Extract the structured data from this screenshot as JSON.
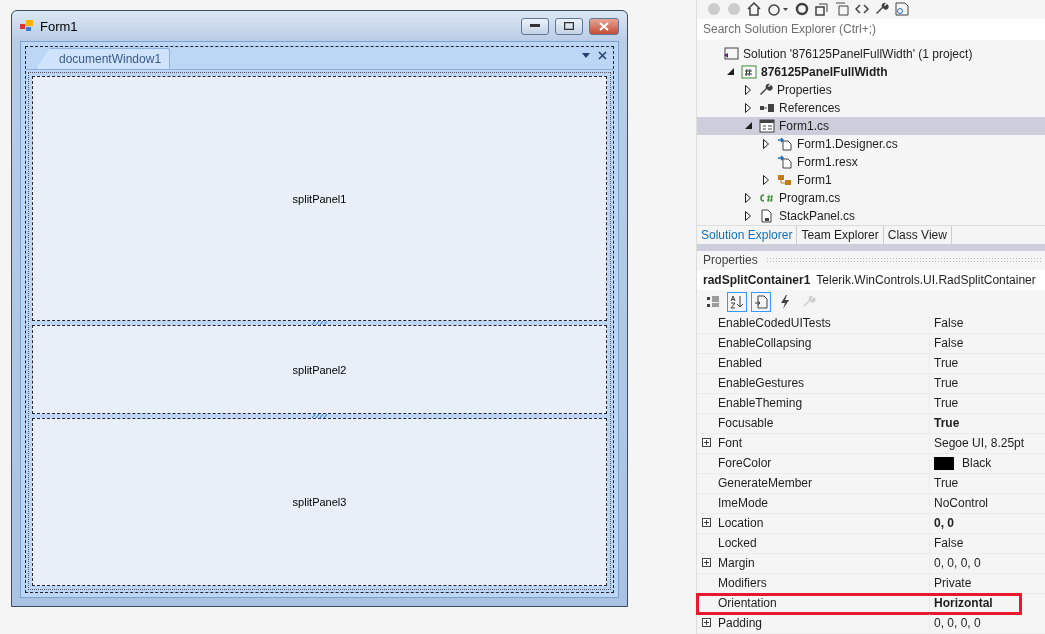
{
  "form": {
    "title": "Form1",
    "document_tab": {
      "label": "documentWindow1",
      "selected": true
    },
    "panels": [
      {
        "label": "splitPanel1"
      },
      {
        "label": "splitPanel2"
      },
      {
        "label": "splitPanel3"
      }
    ]
  },
  "solution_explorer": {
    "search": {
      "placeholder": "Search Solution Explorer (Ctrl+;)"
    },
    "tree": [
      {
        "label": "Solution '876125PanelFullWidth' (1 project)",
        "kind": "solution",
        "expandable": false,
        "bold": false,
        "selected": false,
        "children": [
          {
            "label": "876125PanelFullWidth",
            "kind": "csproject",
            "expandable": true,
            "expanded": true,
            "bold": true,
            "selected": false,
            "children": [
              {
                "label": "Properties",
                "kind": "properties",
                "expandable": true,
                "expanded": false,
                "bold": false,
                "selected": false
              },
              {
                "label": "References",
                "kind": "references",
                "expandable": true,
                "expanded": false,
                "bold": false,
                "selected": false
              },
              {
                "label": "Form1.cs",
                "kind": "form",
                "expandable": true,
                "expanded": true,
                "bold": false,
                "selected": true,
                "children": [
                  {
                    "label": "Form1.Designer.cs",
                    "kind": "designer",
                    "expandable": true,
                    "expanded": false,
                    "bold": false,
                    "selected": false
                  },
                  {
                    "label": "Form1.resx",
                    "kind": "designer",
                    "expandable": false,
                    "bold": false,
                    "selected": false
                  },
                  {
                    "label": "Form1",
                    "kind": "class",
                    "expandable": true,
                    "expanded": false,
                    "bold": false,
                    "selected": false
                  }
                ]
              },
              {
                "label": "Program.cs",
                "kind": "csharp",
                "expandable": true,
                "expanded": false,
                "bold": false,
                "selected": false
              },
              {
                "label": "StackPanel.cs",
                "kind": "file",
                "expandable": true,
                "expanded": false,
                "bold": false,
                "selected": false
              }
            ]
          }
        ]
      }
    ],
    "tabs": [
      {
        "label": "Solution Explorer",
        "selected": true
      },
      {
        "label": "Team Explorer",
        "selected": false
      },
      {
        "label": "Class View",
        "selected": false
      }
    ]
  },
  "properties": {
    "title": "Properties",
    "object_name": "radSplitContainer1",
    "object_type": "Telerik.WinControls.UI.RadSplitContainer",
    "toolbar": [
      {
        "kind": "categorized",
        "selected": false,
        "disabled": false
      },
      {
        "kind": "alphabetical",
        "selected": true,
        "disabled": false
      },
      {
        "kind": "properties",
        "selected": true,
        "disabled": false
      },
      {
        "kind": "events",
        "selected": false,
        "disabled": false
      },
      {
        "kind": "pages",
        "selected": false,
        "disabled": true
      }
    ],
    "rows": [
      {
        "name": "EnableCodedUITests",
        "value": "False",
        "expandable": false,
        "modified": false,
        "highlighted": false
      },
      {
        "name": "EnableCollapsing",
        "value": "False",
        "expandable": false,
        "modified": false,
        "highlighted": false
      },
      {
        "name": "Enabled",
        "value": "True",
        "expandable": false,
        "modified": false,
        "highlighted": false
      },
      {
        "name": "EnableGestures",
        "value": "True",
        "expandable": false,
        "modified": false,
        "highlighted": false
      },
      {
        "name": "EnableTheming",
        "value": "True",
        "expandable": false,
        "modified": false,
        "highlighted": false
      },
      {
        "name": "Focusable",
        "value": "True",
        "expandable": false,
        "modified": true,
        "highlighted": false
      },
      {
        "name": "Font",
        "value": "Segoe UI, 8.25pt",
        "expandable": true,
        "modified": false,
        "highlighted": false
      },
      {
        "name": "ForeColor",
        "value": "Black",
        "expandable": false,
        "modified": false,
        "highlighted": false,
        "color": "#000000"
      },
      {
        "name": "GenerateMember",
        "value": "True",
        "expandable": false,
        "modified": false,
        "highlighted": false
      },
      {
        "name": "ImeMode",
        "value": "NoControl",
        "expandable": false,
        "modified": false,
        "highlighted": false
      },
      {
        "name": "Location",
        "value": "0, 0",
        "expandable": true,
        "modified": true,
        "highlighted": false
      },
      {
        "name": "Locked",
        "value": "False",
        "expandable": false,
        "modified": false,
        "highlighted": false
      },
      {
        "name": "Margin",
        "value": "0, 0, 0, 0",
        "expandable": true,
        "modified": false,
        "highlighted": false
      },
      {
        "name": "Modifiers",
        "value": "Private",
        "expandable": false,
        "modified": false,
        "highlighted": false
      },
      {
        "name": "Orientation",
        "value": "Horizontal",
        "expandable": false,
        "modified": true,
        "highlighted": true
      },
      {
        "name": "Padding",
        "value": "0, 0, 0, 0",
        "expandable": true,
        "modified": false,
        "highlighted": false
      }
    ]
  }
}
